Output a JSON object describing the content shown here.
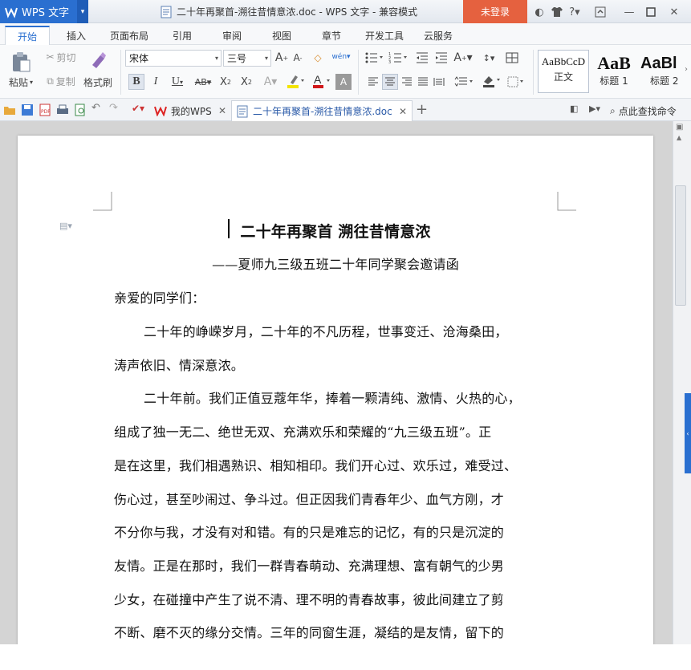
{
  "app": {
    "name": "WPS 文字",
    "window_title": "二十年再聚首-溯往昔情意浓.doc - WPS 文字 - 兼容模式",
    "login_label": "未登录"
  },
  "tabs": [
    "开始",
    "插入",
    "页面布局",
    "引用",
    "审阅",
    "视图",
    "章节",
    "开发工具",
    "云服务"
  ],
  "ribbon": {
    "paste": "粘贴",
    "cut": "剪切",
    "copy": "复制",
    "format_painter": "格式刷",
    "font_name": "宋体",
    "font_size": "三号",
    "styles": [
      {
        "preview": "AaBbCcD",
        "name": "正文"
      },
      {
        "preview": "AaB",
        "name": "标题 1"
      },
      {
        "preview": "AaBl",
        "name": "标题 2"
      }
    ]
  },
  "doc_tabs": {
    "home": "我的WPS",
    "current": "二十年再聚首-溯往昔情意浓.doc",
    "search": "点此查找命令"
  },
  "document": {
    "title": "二十年再聚首  溯往昔情意浓",
    "subtitle": "——夏师九三级五班二十年同学聚会邀请函",
    "salutation": "亲爱的同学们：",
    "lines": [
      "二十年的峥嵘岁月，二十年的不凡历程，世事变迁、沧海桑田，",
      "涛声依旧、情深意浓。",
      "二十年前。我们正值豆蔻年华，捧着一颗清纯、激情、火热的心，",
      "组成了独一无二、绝世无双、充满欢乐和荣耀的“九三级五班”。正",
      "是在这里，我们相遇熟识、相知相印。我们开心过、欢乐过，难受过、",
      "伤心过，甚至吵闹过、争斗过。但正因我们青春年少、血气方刚，才",
      "不分你与我，才没有对和错。有的只是难忘的记忆，有的只是沉淀的",
      "友情。正是在那时，我们一群青春萌动、充满理想、富有朝气的少男",
      "少女，在碰撞中产生了说不清、理不明的青春故事，彼此间建立了剪",
      "不断、磨不灭的缘分交情。三年的同窗生涯，凝结的是友情，留下的"
    ]
  },
  "colors": {
    "accent": "#2a6fd0",
    "login": "#e5613f",
    "workspace": "#d4d4d4"
  }
}
